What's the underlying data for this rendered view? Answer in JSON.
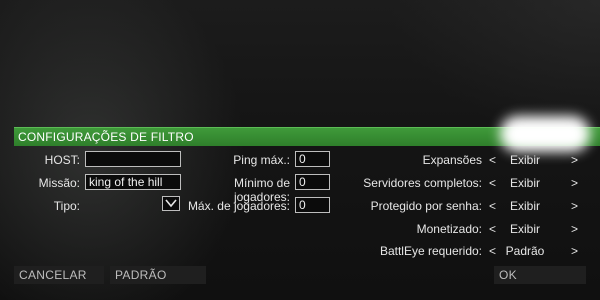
{
  "header": {
    "title": "CONFIGURAÇÕES DE FILTRO"
  },
  "left": {
    "host_label": "HOST:",
    "host_value": "",
    "mission_label": "Missão:",
    "mission_value": "king of the hill",
    "type_label": "Tipo:"
  },
  "middle": {
    "ping_label": "Ping máx.:",
    "ping_value": "0",
    "min_players_label": "Mínimo de jogadores:",
    "min_players_value": "0",
    "max_players_label": "Máx. de jogadores:",
    "max_players_value": "0"
  },
  "right": {
    "prev_arrow": "<",
    "next_arrow": ">",
    "rows": [
      {
        "label": "Expansões",
        "value": "Exibir"
      },
      {
        "label": "Servidores completos:",
        "value": "Exibir"
      },
      {
        "label": "Protegido por senha:",
        "value": "Exibir"
      },
      {
        "label": "Monetizado:",
        "value": "Exibir"
      },
      {
        "label": "BattlEye requerido:",
        "value": "Padrão"
      }
    ]
  },
  "footer": {
    "cancel_label": "CANCELAR",
    "default_label": "PADRÃO",
    "ok_label": "OK"
  },
  "colors": {
    "accent": "#3a8f35",
    "background": "#141414"
  },
  "icons": {
    "type_dropdown": "chevron-down-icon"
  }
}
